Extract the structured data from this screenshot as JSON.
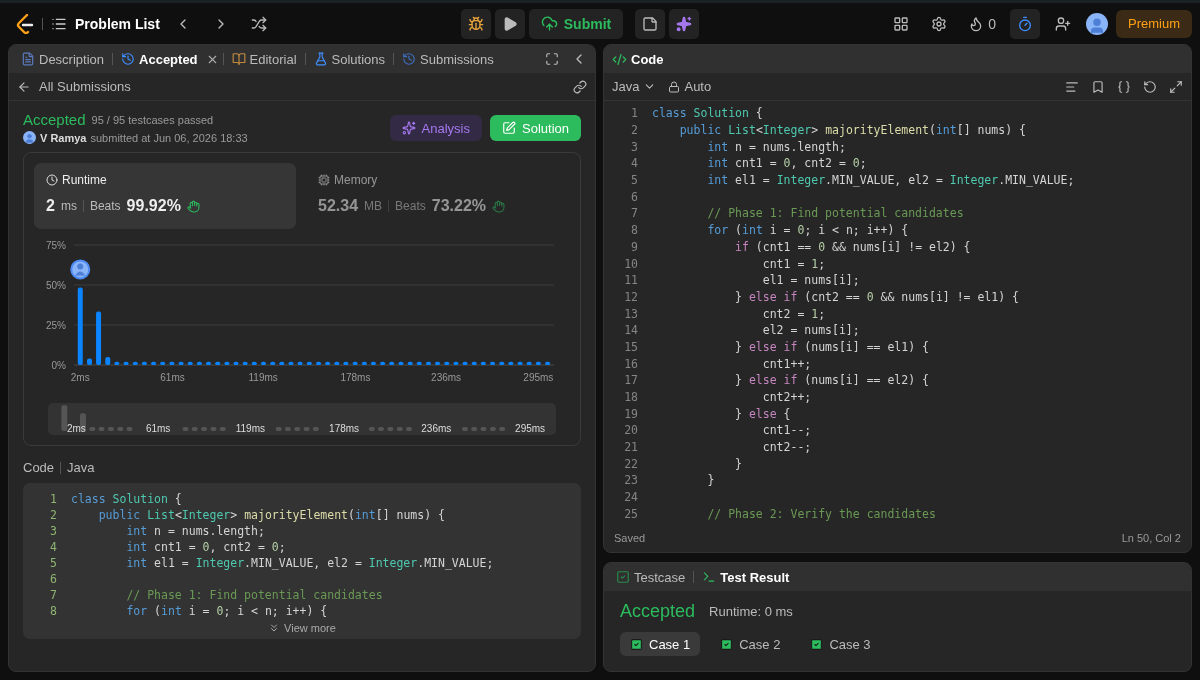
{
  "top_bar": {
    "problem_list": "Problem List",
    "submit": "Submit",
    "streak": "0",
    "premium": "Premium"
  },
  "left_panel": {
    "tabs": [
      {
        "label": "Description",
        "kind": "description",
        "selected": false
      },
      {
        "label": "Accepted",
        "kind": "accepted",
        "selected": true
      },
      {
        "label": "Editorial",
        "kind": "editorial",
        "selected": false
      },
      {
        "label": "Solutions",
        "kind": "solutions",
        "selected": false
      },
      {
        "label": "Submissions",
        "kind": "submissions",
        "selected": false
      }
    ],
    "back": "All Submissions",
    "result": {
      "status": "Accepted",
      "testcases": "95 / 95 testcases passed",
      "user": "V Ramya",
      "submitted": "submitted at Jun 06, 2026 18:33"
    },
    "buttons": [
      {
        "label": "Analysis",
        "kind": "ai"
      },
      {
        "label": "Solution",
        "kind": "primary"
      }
    ],
    "metrics": [
      {
        "kind": "runtime",
        "title": "Runtime",
        "value": "2",
        "unit": "ms",
        "beats_label": "Beats",
        "beats": "99.92%",
        "selected": true
      },
      {
        "kind": "memory",
        "title": "Memory",
        "value": "52.34",
        "unit": "MB",
        "beats_label": "Beats",
        "beats": "73.22%",
        "selected": false
      }
    ],
    "chart_data": {
      "type": "bar",
      "ylim": [
        0,
        75
      ],
      "xlim": [
        -2,
        305
      ],
      "yticks": [
        {
          "value": 0,
          "label": "0%"
        },
        {
          "value": 25,
          "label": "25%"
        },
        {
          "value": 50,
          "label": "50%"
        },
        {
          "value": 75,
          "label": "75%"
        }
      ],
      "x": [
        2,
        7.9,
        13.7,
        19.6,
        25.4,
        31.3,
        37.2,
        43,
        48.9,
        54.7,
        60.6,
        66.5,
        72.3,
        78.2,
        84,
        89.9,
        95.8,
        101.6,
        107.5,
        113.3,
        119.2,
        125.1,
        130.9,
        136.8,
        142.6,
        148.5,
        154.4,
        160.2,
        166.1,
        171.9,
        177.8,
        183.7,
        189.5,
        195.4,
        201.2,
        207.1,
        213,
        218.8,
        224.7,
        230.5,
        236.4,
        242.3,
        248.1,
        254,
        259.8,
        265.7,
        271.6,
        277.4,
        283.3,
        289.1,
        295,
        300.9
      ],
      "xticks": [
        {
          "value": 2,
          "label": "2ms"
        },
        {
          "value": 61,
          "label": "61ms"
        },
        {
          "value": 119,
          "label": "119ms"
        },
        {
          "value": 178,
          "label": "178ms"
        },
        {
          "value": 236,
          "label": "236ms"
        },
        {
          "value": 295,
          "label": "295ms"
        }
      ],
      "values": [
        48.5,
        4,
        33.5,
        5,
        2,
        2,
        2,
        2,
        2,
        2,
        2,
        2,
        2,
        2,
        2,
        2,
        2,
        2,
        2,
        2,
        2,
        2,
        2,
        2,
        2,
        2,
        2,
        2,
        2,
        2,
        2,
        2,
        2,
        2,
        2,
        2,
        2,
        2,
        2,
        2,
        2,
        2,
        2,
        2,
        2,
        2,
        2,
        2,
        2,
        2,
        2,
        2
      ]
    },
    "navigator": {
      "labels": [
        "2ms",
        "61ms",
        "119ms",
        "178ms",
        "236ms",
        "295ms"
      ]
    },
    "code_header": {
      "title": "Code",
      "language": "Java"
    },
    "code_lines": [
      {
        "n": "1",
        "tokens": [
          {
            "kind": "kw",
            "text": "class "
          },
          {
            "kind": "type",
            "text": "Solution"
          },
          {
            "kind": "p",
            "text": " {"
          }
        ]
      },
      {
        "n": "2",
        "tokens": [
          {
            "kind": "kw",
            "text": "    public "
          },
          {
            "kind": "type",
            "text": "List"
          },
          {
            "kind": "p",
            "text": "<"
          },
          {
            "kind": "type",
            "text": "Integer"
          },
          {
            "kind": "p",
            "text": "> "
          },
          {
            "kind": "fn",
            "text": "majorityElement"
          },
          {
            "kind": "p",
            "text": "("
          },
          {
            "kind": "kw",
            "text": "int"
          },
          {
            "kind": "p",
            "text": "[] nums) {"
          }
        ]
      },
      {
        "n": "3",
        "tokens": [
          {
            "kind": "kw",
            "text": "        int"
          },
          {
            "kind": "p",
            "text": " n = nums.length;"
          }
        ]
      },
      {
        "n": "4",
        "tokens": [
          {
            "kind": "kw",
            "text": "        int"
          },
          {
            "kind": "p",
            "text": " cnt1 = "
          },
          {
            "kind": "num",
            "text": "0"
          },
          {
            "kind": "p",
            "text": ", cnt2 = "
          },
          {
            "kind": "num",
            "text": "0"
          },
          {
            "kind": "p",
            "text": ";"
          }
        ]
      },
      {
        "n": "5",
        "tokens": [
          {
            "kind": "kw",
            "text": "        int"
          },
          {
            "kind": "p",
            "text": " el1 = "
          },
          {
            "kind": "type",
            "text": "Integer"
          },
          {
            "kind": "p",
            "text": ".MIN_VALUE, el2 = "
          },
          {
            "kind": "type",
            "text": "Integer"
          },
          {
            "kind": "p",
            "text": ".MIN_VALUE;"
          }
        ]
      },
      {
        "n": "6"
      },
      {
        "n": "7",
        "tokens": [
          {
            "kind": "cm",
            "text": "        // Phase 1: Find potential candidates"
          }
        ]
      },
      {
        "n": "8",
        "tokens": [
          {
            "kind": "kw",
            "text": "        for"
          },
          {
            "kind": "p",
            "text": " ("
          },
          {
            "kind": "kw",
            "text": "int"
          },
          {
            "kind": "p",
            "text": " i = "
          },
          {
            "kind": "num",
            "text": "0"
          },
          {
            "kind": "p",
            "text": "; i < n; i++) {"
          }
        ]
      }
    ],
    "view_more": "View more"
  },
  "editor": {
    "title": "Code",
    "language": "Java",
    "mode": "Auto",
    "lines": [
      {
        "n": "1",
        "tokens": [
          {
            "kind": "kw",
            "text": "class "
          },
          {
            "kind": "type",
            "text": "Solution"
          },
          {
            "kind": "p",
            "text": " {"
          }
        ]
      },
      {
        "n": "2",
        "tokens": [
          {
            "kind": "kw",
            "text": "    public "
          },
          {
            "kind": "type",
            "text": "List"
          },
          {
            "kind": "p",
            "text": "<"
          },
          {
            "kind": "type",
            "text": "Integer"
          },
          {
            "kind": "p",
            "text": "> "
          },
          {
            "kind": "fn",
            "text": "majorityElement"
          },
          {
            "kind": "p",
            "text": "("
          },
          {
            "kind": "kw",
            "text": "int"
          },
          {
            "kind": "p",
            "text": "[] nums) {"
          }
        ]
      },
      {
        "n": "3",
        "tokens": [
          {
            "kind": "kw",
            "text": "        int"
          },
          {
            "kind": "p",
            "text": " n = nums.length;"
          }
        ]
      },
      {
        "n": "4",
        "tokens": [
          {
            "kind": "kw",
            "text": "        int"
          },
          {
            "kind": "p",
            "text": " cnt1 = "
          },
          {
            "kind": "num",
            "text": "0"
          },
          {
            "kind": "p",
            "text": ", cnt2 = "
          },
          {
            "kind": "num",
            "text": "0"
          },
          {
            "kind": "p",
            "text": ";"
          }
        ]
      },
      {
        "n": "5",
        "tokens": [
          {
            "kind": "kw",
            "text": "        int"
          },
          {
            "kind": "p",
            "text": " el1 = "
          },
          {
            "kind": "type",
            "text": "Integer"
          },
          {
            "kind": "p",
            "text": ".MIN_VALUE, el2 = "
          },
          {
            "kind": "type",
            "text": "Integer"
          },
          {
            "kind": "p",
            "text": ".MIN_VALUE;"
          }
        ]
      },
      {
        "n": "6"
      },
      {
        "n": "7",
        "tokens": [
          {
            "kind": "cm",
            "text": "        // Phase 1: Find potential candidates"
          }
        ]
      },
      {
        "n": "8",
        "tokens": [
          {
            "kind": "kw",
            "text": "        for"
          },
          {
            "kind": "p",
            "text": " ("
          },
          {
            "kind": "kw",
            "text": "int"
          },
          {
            "kind": "p",
            "text": " i = "
          },
          {
            "kind": "num",
            "text": "0"
          },
          {
            "kind": "p",
            "text": "; i < n; i++) {"
          }
        ]
      },
      {
        "n": "9",
        "tokens": [
          {
            "kind": "ctl",
            "text": "            if"
          },
          {
            "kind": "p",
            "text": " (cnt1 == "
          },
          {
            "kind": "num",
            "text": "0"
          },
          {
            "kind": "p",
            "text": " && nums[i] != el2) {"
          }
        ]
      },
      {
        "n": "10",
        "tokens": [
          {
            "kind": "p",
            "text": "                cnt1 = "
          },
          {
            "kind": "num",
            "text": "1"
          },
          {
            "kind": "p",
            "text": ";"
          }
        ]
      },
      {
        "n": "11",
        "tokens": [
          {
            "kind": "p",
            "text": "                el1 = nums[i];"
          }
        ]
      },
      {
        "n": "12",
        "tokens": [
          {
            "kind": "p",
            "text": "            } "
          },
          {
            "kind": "ctl",
            "text": "else if"
          },
          {
            "kind": "p",
            "text": " (cnt2 == "
          },
          {
            "kind": "num",
            "text": "0"
          },
          {
            "kind": "p",
            "text": " && nums[i] != el1) {"
          }
        ]
      },
      {
        "n": "13",
        "tokens": [
          {
            "kind": "p",
            "text": "                cnt2 = "
          },
          {
            "kind": "num",
            "text": "1"
          },
          {
            "kind": "p",
            "text": ";"
          }
        ]
      },
      {
        "n": "14",
        "tokens": [
          {
            "kind": "p",
            "text": "                el2 = nums[i];"
          }
        ]
      },
      {
        "n": "15",
        "tokens": [
          {
            "kind": "p",
            "text": "            } "
          },
          {
            "kind": "ctl",
            "text": "else if"
          },
          {
            "kind": "p",
            "text": " (nums[i] == el1) {"
          }
        ]
      },
      {
        "n": "16",
        "tokens": [
          {
            "kind": "p",
            "text": "                cnt1++;"
          }
        ]
      },
      {
        "n": "17",
        "tokens": [
          {
            "kind": "p",
            "text": "            } "
          },
          {
            "kind": "ctl",
            "text": "else if"
          },
          {
            "kind": "p",
            "text": " (nums[i] == el2) {"
          }
        ]
      },
      {
        "n": "18",
        "tokens": [
          {
            "kind": "p",
            "text": "                cnt2++;"
          }
        ]
      },
      {
        "n": "19",
        "tokens": [
          {
            "kind": "p",
            "text": "            } "
          },
          {
            "kind": "ctl",
            "text": "else"
          },
          {
            "kind": "p",
            "text": " {"
          }
        ]
      },
      {
        "n": "20",
        "tokens": [
          {
            "kind": "p",
            "text": "                cnt1--;"
          }
        ]
      },
      {
        "n": "21",
        "tokens": [
          {
            "kind": "p",
            "text": "                cnt2--;"
          }
        ]
      },
      {
        "n": "22",
        "tokens": [
          {
            "kind": "p",
            "text": "            }"
          }
        ]
      },
      {
        "n": "23",
        "tokens": [
          {
            "kind": "p",
            "text": "        }"
          }
        ]
      },
      {
        "n": "24"
      },
      {
        "n": "25",
        "tokens": [
          {
            "kind": "cm",
            "text": "        // Phase 2: Verify the candidates"
          }
        ]
      }
    ],
    "status": "Saved",
    "cursor": "Ln 50, Col 2"
  },
  "test_panel": {
    "tabs": [
      {
        "label": "Testcase",
        "kind": "testcase",
        "selected": false
      },
      {
        "label": "Test Result",
        "kind": "result",
        "selected": true
      }
    ],
    "status": "Accepted",
    "runtime": "Runtime: 0 ms",
    "cases": [
      {
        "label": "Case 1",
        "selected": true,
        "passed": true
      },
      {
        "label": "Case 2",
        "selected": false,
        "passed": true
      },
      {
        "label": "Case 3",
        "selected": false,
        "passed": true
      }
    ]
  }
}
